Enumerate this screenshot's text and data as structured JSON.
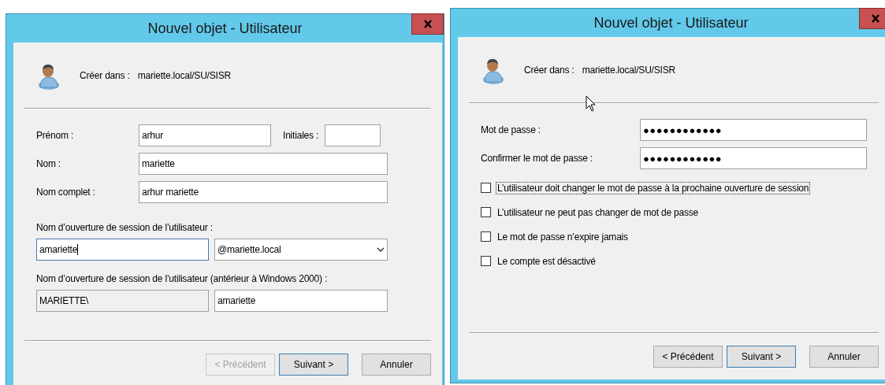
{
  "dialogs": [
    {
      "kind": "names",
      "title": "Nouvel objet - Utilisateur",
      "create_in_label": "Créer dans :",
      "create_in_path": "mariette.local/SU/SISR",
      "items": [
        {
          "kind": "name-row",
          "label": "Prénom :",
          "value": "arhur",
          "extra_label": "Initiales :"
        },
        {
          "kind": "field",
          "label": "Nom :",
          "value": "mariette"
        },
        {
          "kind": "field",
          "label": "Nom complet :",
          "value": "arhur mariette"
        },
        {
          "kind": "caption",
          "text": "Nom d’ouverture de session de l’utilisateur :"
        },
        {
          "kind": "pair",
          "left": {
            "value": "amariette",
            "focused": true,
            "readonly": false
          },
          "right": {
            "value": "@mariette.local",
            "dropdown": true
          }
        },
        {
          "kind": "caption",
          "text": "Nom d’ouverture de session de l’utilisateur (antérieur à Windows 2000) :"
        },
        {
          "kind": "pair",
          "left": {
            "value": "MARIETTE\\",
            "focused": false,
            "readonly": true
          },
          "right": {
            "value": "amariette",
            "dropdown": false
          }
        }
      ],
      "buttons": [
        {
          "label": "< Précédent",
          "disabled": true,
          "default": false
        },
        {
          "label": "Suivant >",
          "disabled": false,
          "default": true
        },
        {
          "label": "Annuler",
          "disabled": false,
          "default": false
        }
      ]
    },
    {
      "kind": "password",
      "title": "Nouvel objet - Utilisateur",
      "create_in_label": "Créer dans :",
      "create_in_path": "mariette.local/SU/SISR",
      "items": [
        {
          "kind": "field",
          "label": "Mot de passe :",
          "value": "●●●●●●●●●●●●"
        },
        {
          "kind": "field",
          "label": "Confirmer le mot de passe :",
          "value": "●●●●●●●●●●●●"
        },
        {
          "kind": "checkbox",
          "label": "L’utilisateur doit changer le mot de passe à la prochaine ouverture de session",
          "checked": false,
          "focused": true
        },
        {
          "kind": "checkbox",
          "label": "L’utilisateur ne peut pas changer de mot de passe",
          "checked": false,
          "focused": false
        },
        {
          "kind": "checkbox",
          "label": "Le mot de passe n’expire jamais",
          "checked": false,
          "focused": false
        },
        {
          "kind": "checkbox",
          "label": "Le compte est désactivé",
          "checked": false,
          "focused": false
        }
      ],
      "buttons": [
        {
          "label": "< Précédent",
          "disabled": false,
          "default": false
        },
        {
          "label": "Suivant >",
          "disabled": false,
          "default": true
        },
        {
          "label": "Annuler",
          "disabled": false,
          "default": false
        }
      ]
    }
  ]
}
